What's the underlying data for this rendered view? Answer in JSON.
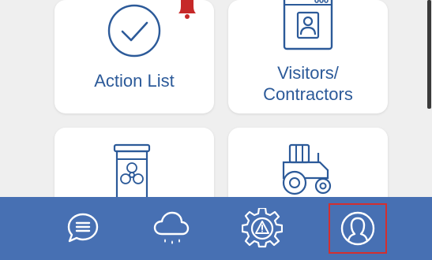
{
  "tiles": {
    "action_list": {
      "label": "Action List",
      "icon": "checkmark-circle-icon"
    },
    "visitors": {
      "label_line1": "Visitors/",
      "label_line2": "Contractors",
      "icon": "visitor-badge-icon"
    },
    "hazardous": {
      "icon": "biohazard-drum-icon"
    },
    "equipment": {
      "icon": "tractor-icon"
    }
  },
  "notification": {
    "icon": "bell-icon",
    "color": "#c62828"
  },
  "bottom_nav": {
    "items": [
      {
        "icon": "chat-bubble-icon"
      },
      {
        "icon": "weather-rain-icon"
      },
      {
        "icon": "gear-warning-icon"
      },
      {
        "icon": "user-profile-icon",
        "active": true
      }
    ]
  },
  "colors": {
    "accent": "#2c5a99",
    "nav_background": "#4770b3",
    "active_highlight": "#d32f2f",
    "page_background": "#efefef"
  }
}
